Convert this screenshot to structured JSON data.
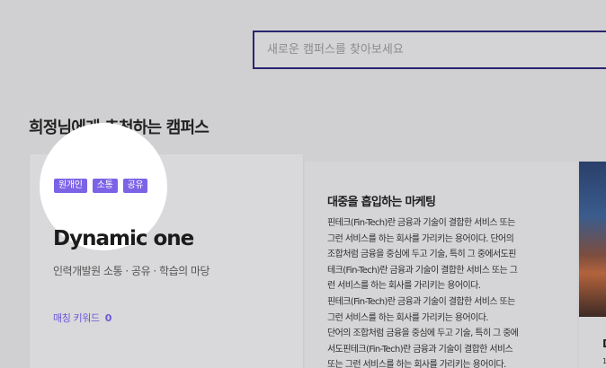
{
  "search": {
    "placeholder": "새로운 캠퍼스를 찾아보세요"
  },
  "section": {
    "title": "희정님에게 추천하는 캠퍼스"
  },
  "cards": [
    {
      "tags": [
        "원개인",
        "소통",
        "공유"
      ],
      "title": "Dynamic one",
      "subtitle": "인력개발원 소통 · 공유 · 학습의 마당",
      "keyword_label": "매칭 키워드",
      "keyword_count": "0"
    },
    {
      "title": "대중을 흡입하는 마케팅",
      "body": "핀테크(Fin-Tech)란 금융과 기술이 결합한 서비스 또는\n그런 서비스를 하는 회사를 가리키는 용어이다. 단어의\n조합처럼 금융을 중심에 두고 기술, 특히 그 중에서도핀\n테크(Fin-Tech)란 금융과 기술이 결합한 서비스 또는 그\n런 서비스를 하는 회사를 가리키는 용어이다.\n핀테크(Fin-Tech)란 금융과 기술이 결합한 서비스 또는\n그런 서비스를 하는 회사를 가리키는 용어이다.\n단어의 조합처럼 금융을 중심에 두고 기술, 특히 그 중에\n서도핀테크(Fin-Tech)란 금융과 기술이 결합한 서비스\n또는 그런 서비스를 하는 회사를 가리키는 용어이다."
    },
    {
      "title_initial": "D",
      "small_text": "1"
    }
  ]
}
